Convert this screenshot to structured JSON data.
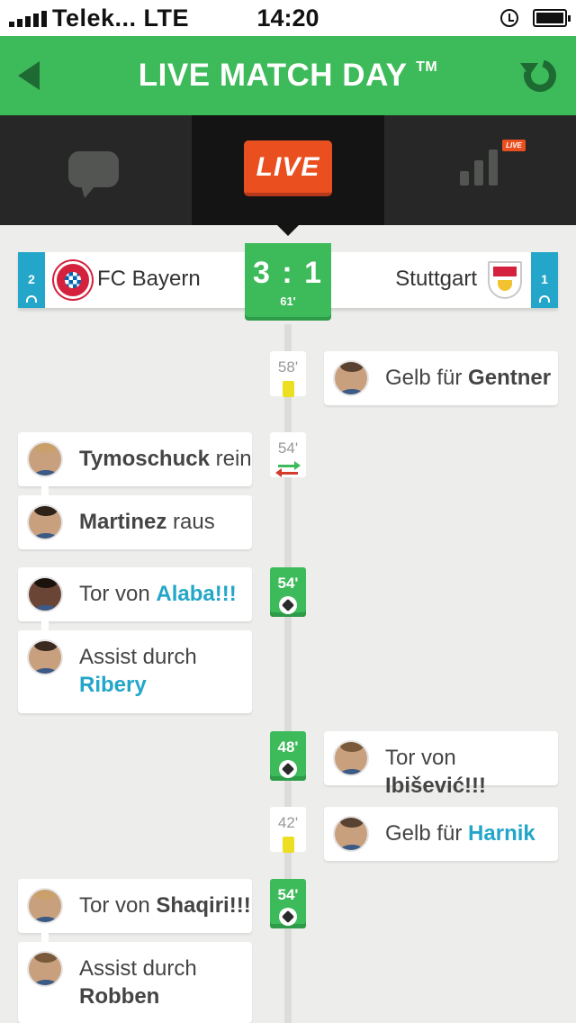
{
  "status_bar": {
    "carrier": "Telek... LTE",
    "time": "14:20"
  },
  "header": {
    "title": "LIVE MATCH DAY",
    "trademark": "TM"
  },
  "tabs": [
    {
      "id": "chat",
      "icon": "chat-bubble-icon"
    },
    {
      "id": "live",
      "label": "LIVE",
      "active": true
    },
    {
      "id": "stats",
      "icon": "bar-chart-icon",
      "badge": "LIVE"
    }
  ],
  "match": {
    "home": {
      "name": "FC Bayern",
      "count": "2",
      "crest": "fc-bayern-crest"
    },
    "away": {
      "name": "Stuttgart",
      "count": "1",
      "crest": "vfb-stuttgart-crest"
    },
    "score": "3 : 1",
    "minute": "61'"
  },
  "events": [
    {
      "minute": "58'",
      "type": "yellow",
      "side": "right",
      "prefix": "Gelb für ",
      "player": "Gentner"
    },
    {
      "minute": "54'",
      "type": "substitution",
      "side": "left",
      "prefix": "",
      "player": "Tymoschuck",
      "suffix": " rein"
    },
    {
      "minute": "",
      "type": "substitution-out",
      "side": "left",
      "prefix": "",
      "player": "Martinez",
      "suffix": " raus"
    },
    {
      "minute": "54'",
      "type": "goal",
      "side": "left",
      "prefix": "Tor von ",
      "player": "Alaba!!!"
    },
    {
      "minute": "",
      "type": "assist",
      "side": "left",
      "prefix": "Assist durch",
      "player": "Ribery"
    },
    {
      "minute": "48'",
      "type": "goal",
      "side": "right",
      "prefix": "Tor von ",
      "player": "Ibišević!!!"
    },
    {
      "minute": "42'",
      "type": "yellow",
      "side": "right",
      "prefix": "Gelb für ",
      "player": "Harnik"
    },
    {
      "minute": "54'",
      "type": "goal",
      "side": "left",
      "prefix": "Tor von ",
      "player": "Shaqiri!!!"
    },
    {
      "minute": "",
      "type": "assist",
      "side": "left",
      "prefix": "Assist durch",
      "player": "Robben"
    }
  ],
  "colors": {
    "green": "#3dba5a",
    "live_orange": "#ea4f20",
    "accent_blue": "#23a6c9",
    "dark_tabbar": "#262726"
  }
}
